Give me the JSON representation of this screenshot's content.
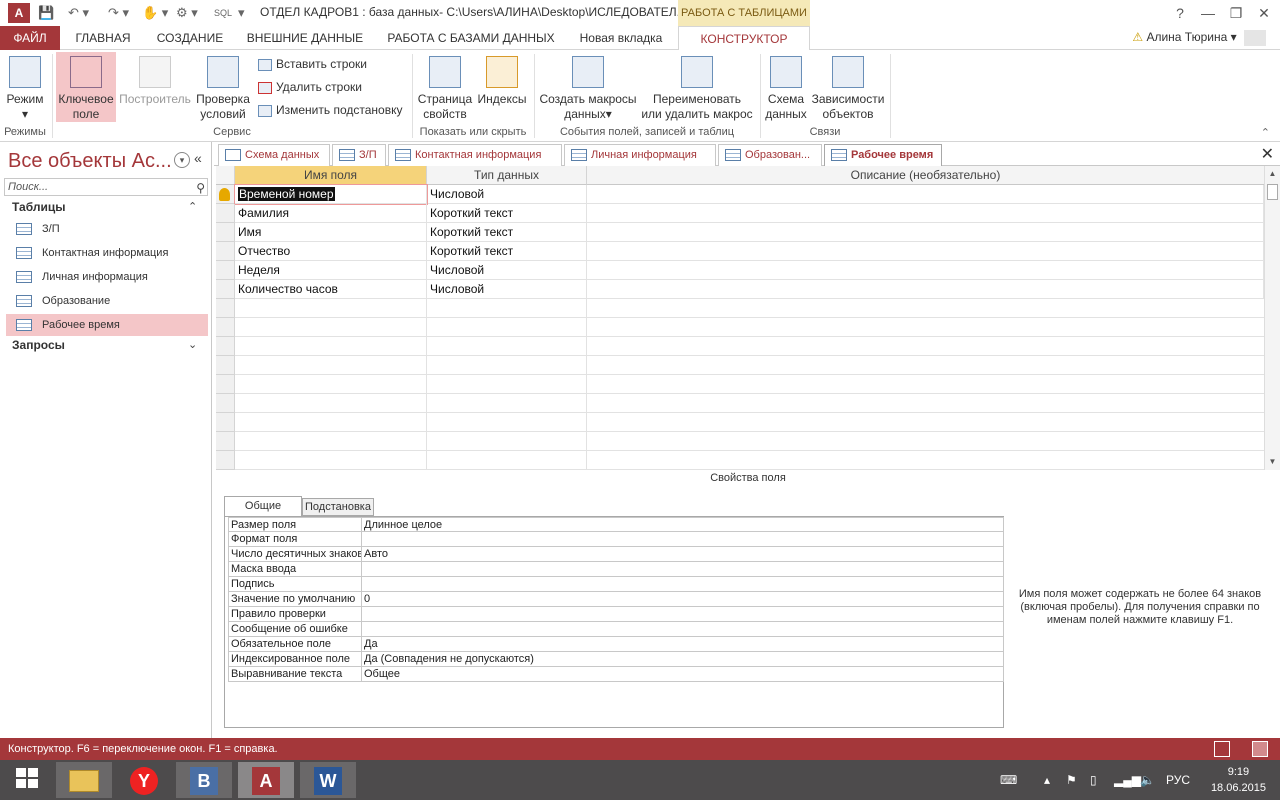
{
  "titlebar": {
    "app_logo": "A",
    "title": "ОТДЕЛ КАДРОВ1 : база данных- C:\\Users\\АЛИНА\\Desktop\\ИСЛЕДОВАТЕЛ...",
    "sql_label": "SQL",
    "context_tab": "РАБОТА С ТАБЛИЦАМИ",
    "help": "?",
    "minimize": "—",
    "restore": "❐",
    "close": "✕"
  },
  "ribbon_tabs": [
    {
      "label": "ФАЙЛ"
    },
    {
      "label": "ГЛАВНАЯ"
    },
    {
      "label": "СОЗДАНИЕ"
    },
    {
      "label": "ВНЕШНИЕ ДАННЫЕ"
    },
    {
      "label": "РАБОТА С БАЗАМИ ДАННЫХ"
    },
    {
      "label": "Новая вкладка"
    },
    {
      "label": "КОНСТРУКТОР"
    }
  ],
  "user": {
    "name": "Алина Тюрина",
    "warn": "⚠"
  },
  "ribbon": {
    "view": "Режим",
    "primary_key_1": "Ключевое",
    "primary_key_2": "поле",
    "builder": "Построитель",
    "test_rules_1": "Проверка",
    "test_rules_2": "условий",
    "insert_rows": "Вставить строки",
    "delete_rows": "Удалить строки",
    "modify_lookups": "Изменить подстановку",
    "property_sheet_1": "Страница",
    "property_sheet_2": "свойств",
    "indexes": "Индексы",
    "create_macros_1": "Создать макросы",
    "create_macros_2": "данных",
    "rename_macro_1": "Переименовать",
    "rename_macro_2": "или удалить макрос",
    "relationships_1": "Схема",
    "relationships_2": "данных",
    "dependencies_1": "Зависимости",
    "dependencies_2": "объектов",
    "groups": {
      "views": "Режимы",
      "tools": "Сервис",
      "show_hide": "Показать или скрыть",
      "events": "События полей, записей и таблиц",
      "relationships": "Связи"
    }
  },
  "nav": {
    "title": "Все объекты Ac...",
    "search_placeholder": "Поиск...",
    "section_tables": "Таблицы",
    "section_queries": "Запросы",
    "items": [
      {
        "label": "З/П"
      },
      {
        "label": "Контактная информация"
      },
      {
        "label": "Личная информация"
      },
      {
        "label": "Образование"
      },
      {
        "label": "Рабочее время"
      }
    ]
  },
  "doc_tabs": [
    {
      "label": "Схема данных"
    },
    {
      "label": "З/П"
    },
    {
      "label": "Контактная информация"
    },
    {
      "label": "Личная информация"
    },
    {
      "label": "Образован..."
    },
    {
      "label": "Рабочее время"
    }
  ],
  "grid": {
    "headers": {
      "field": "Имя поля",
      "type": "Тип данных",
      "desc": "Описание (необязательно)"
    },
    "rows": [
      {
        "field": "Временой номер",
        "type": "Числовой"
      },
      {
        "field": "Фамилия",
        "type": "Короткий текст"
      },
      {
        "field": "Имя",
        "type": "Короткий текст"
      },
      {
        "field": "Отчество",
        "type": "Короткий текст"
      },
      {
        "field": "Неделя",
        "type": "Числовой"
      },
      {
        "field": "Количество часов",
        "type": "Числовой"
      }
    ]
  },
  "field_props": {
    "title": "Свойства поля",
    "tab_general": "Общие",
    "tab_lookup": "Подстановка",
    "rows": [
      {
        "label": "Размер поля",
        "value": "Длинное целое"
      },
      {
        "label": "Формат поля",
        "value": ""
      },
      {
        "label": "Число десятичных знаков",
        "value": "Авто"
      },
      {
        "label": "Маска ввода",
        "value": ""
      },
      {
        "label": "Подпись",
        "value": ""
      },
      {
        "label": "Значение по умолчанию",
        "value": "0"
      },
      {
        "label": "Правило проверки",
        "value": ""
      },
      {
        "label": "Сообщение об ошибке",
        "value": ""
      },
      {
        "label": "Обязательное поле",
        "value": "Да"
      },
      {
        "label": "Индексированное поле",
        "value": "Да (Совпадения не допускаются)"
      },
      {
        "label": "Выравнивание текста",
        "value": "Общее"
      }
    ],
    "help": "Имя поля может содержать не более 64 знаков (включая пробелы). Для получения справки по именам полей нажмите клавишу F1."
  },
  "status": {
    "text": "Конструктор.  F6 = переключение окон.  F1 = справка."
  },
  "taskbar": {
    "browser": "Y",
    "vk": "B",
    "access": "A",
    "word": "W",
    "lang": "РУС",
    "time": "9:19",
    "date": "18.06.2015"
  },
  "colors": {
    "brand": "#a4373a",
    "accent_selected": "#f4c6c8",
    "context_tab": "#f5e9b8"
  }
}
